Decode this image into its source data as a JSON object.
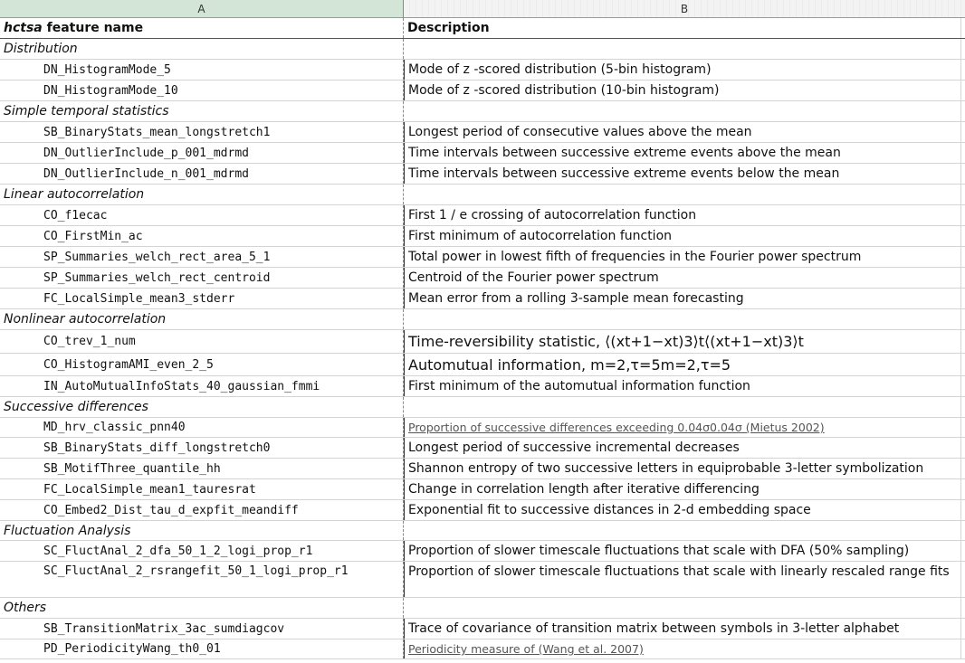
{
  "columns": {
    "a": "A",
    "b": "B"
  },
  "header": {
    "feature_em": "hctsa",
    "feature_rest": " feature name",
    "description": "Description"
  },
  "rows": [
    {
      "type": "section",
      "name": "Distribution"
    },
    {
      "type": "feature",
      "name": "DN_HistogramMode_5",
      "desc": "Mode of z -scored distribution (5-bin histogram)"
    },
    {
      "type": "feature",
      "name": "DN_HistogramMode_10",
      "desc": "Mode of z -scored distribution (10-bin histogram)"
    },
    {
      "type": "section",
      "name": "Simple temporal statistics"
    },
    {
      "type": "feature",
      "name": "SB_BinaryStats_mean_longstretch1",
      "desc": "Longest period of consecutive values above the mean"
    },
    {
      "type": "feature",
      "name": "DN_OutlierInclude_p_001_mdrmd",
      "desc": "Time intervals between successive extreme events above the mean"
    },
    {
      "type": "feature",
      "name": "DN_OutlierInclude_n_001_mdrmd",
      "desc": "Time intervals between successive extreme events below the mean"
    },
    {
      "type": "section",
      "name": "Linear autocorrelation"
    },
    {
      "type": "feature",
      "name": "CO_f1ecac",
      "desc": "First 1 / e  crossing of autocorrelation function"
    },
    {
      "type": "feature",
      "name": "CO_FirstMin_ac",
      "desc": "First minimum of autocorrelation function"
    },
    {
      "type": "feature",
      "name": "SP_Summaries_welch_rect_area_5_1",
      "desc": "Total power in lowest fifth of frequencies in the Fourier power spectrum"
    },
    {
      "type": "feature",
      "name": "SP_Summaries_welch_rect_centroid",
      "desc": "Centroid of the Fourier power spectrum"
    },
    {
      "type": "feature",
      "name": "FC_LocalSimple_mean3_stderr",
      "desc": "Mean error from a rolling 3-sample mean forecasting"
    },
    {
      "type": "section",
      "name": "Nonlinear autocorrelation"
    },
    {
      "type": "feature",
      "name": "CO_trev_1_num",
      "desc": "Time-reversibility statistic, ⟨(xt+1−xt)3⟩t⟨(xt+1−xt)3⟩t",
      "style": "big"
    },
    {
      "type": "feature",
      "name": "CO_HistogramAMI_even_2_5",
      "desc": "Automutual information, m=2,τ=5m=2,τ=5",
      "style": "big"
    },
    {
      "type": "feature",
      "name": "IN_AutoMutualInfoStats_40_gaussian_fmmi",
      "desc": "First minimum of the automutual information function"
    },
    {
      "type": "section",
      "name": "Successive differences"
    },
    {
      "type": "feature",
      "name": "MD_hrv_classic_pnn40",
      "desc": "Proportion of successive differences exceeding 0.04σ0.04σ (Mietus 2002)",
      "style": "link"
    },
    {
      "type": "feature",
      "name": "SB_BinaryStats_diff_longstretch0",
      "desc": "Longest period of successive incremental decreases"
    },
    {
      "type": "feature",
      "name": "SB_MotifThree_quantile_hh",
      "desc": "Shannon entropy of two successive letters in equiprobable 3-letter symbolization"
    },
    {
      "type": "feature",
      "name": "FC_LocalSimple_mean1_tauresrat",
      "desc": "Change in correlation length after iterative differencing"
    },
    {
      "type": "feature",
      "name": "CO_Embed2_Dist_tau_d_expfit_meandiff",
      "desc": "Exponential fit to successive distances in 2-d embedding space"
    },
    {
      "type": "section",
      "name": "Fluctuation Analysis"
    },
    {
      "type": "feature",
      "name": "SC_FluctAnal_2_dfa_50_1_2_logi_prop_r1",
      "desc": "Proportion of slower timescale fluctuations that scale with DFA (50% sampling)"
    },
    {
      "type": "feature",
      "name": "SC_FluctAnal_2_rsrangefit_50_1_logi_prop_r1",
      "desc": "Proportion of slower timescale fluctuations that scale with linearly rescaled range fits",
      "style": "tall"
    },
    {
      "type": "section",
      "name": "Others"
    },
    {
      "type": "feature",
      "name": "SB_TransitionMatrix_3ac_sumdiagcov",
      "desc": "Trace of covariance of transition matrix between symbols in 3-letter alphabet"
    },
    {
      "type": "feature",
      "name": "PD_PeriodicityWang_th0_01",
      "desc": "Periodicity measure of (Wang et al. 2007)",
      "style": "link"
    }
  ]
}
